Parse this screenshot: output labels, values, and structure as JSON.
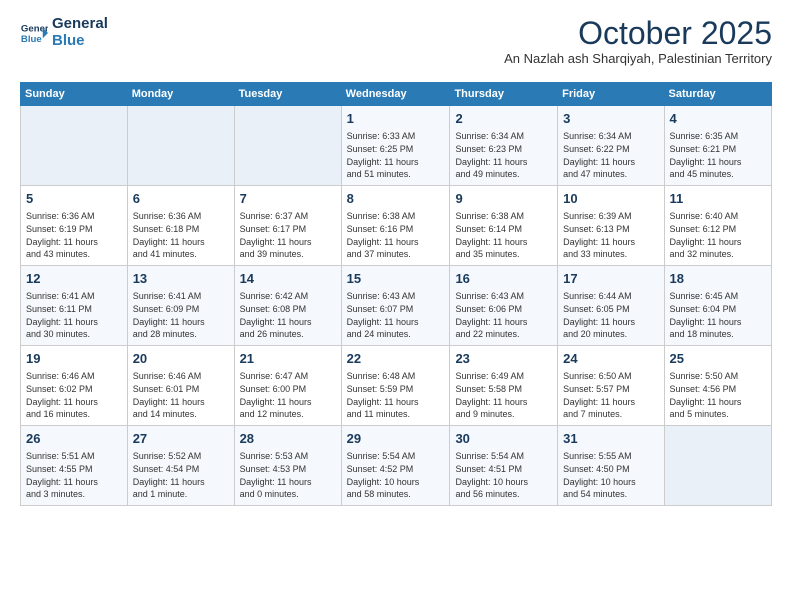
{
  "header": {
    "logo_line1": "General",
    "logo_line2": "Blue",
    "month": "October 2025",
    "location": "An Nazlah ash Sharqiyah, Palestinian Territory"
  },
  "weekdays": [
    "Sunday",
    "Monday",
    "Tuesday",
    "Wednesday",
    "Thursday",
    "Friday",
    "Saturday"
  ],
  "weeks": [
    [
      {
        "day": "",
        "info": ""
      },
      {
        "day": "",
        "info": ""
      },
      {
        "day": "",
        "info": ""
      },
      {
        "day": "1",
        "info": "Sunrise: 6:33 AM\nSunset: 6:25 PM\nDaylight: 11 hours\nand 51 minutes."
      },
      {
        "day": "2",
        "info": "Sunrise: 6:34 AM\nSunset: 6:23 PM\nDaylight: 11 hours\nand 49 minutes."
      },
      {
        "day": "3",
        "info": "Sunrise: 6:34 AM\nSunset: 6:22 PM\nDaylight: 11 hours\nand 47 minutes."
      },
      {
        "day": "4",
        "info": "Sunrise: 6:35 AM\nSunset: 6:21 PM\nDaylight: 11 hours\nand 45 minutes."
      }
    ],
    [
      {
        "day": "5",
        "info": "Sunrise: 6:36 AM\nSunset: 6:19 PM\nDaylight: 11 hours\nand 43 minutes."
      },
      {
        "day": "6",
        "info": "Sunrise: 6:36 AM\nSunset: 6:18 PM\nDaylight: 11 hours\nand 41 minutes."
      },
      {
        "day": "7",
        "info": "Sunrise: 6:37 AM\nSunset: 6:17 PM\nDaylight: 11 hours\nand 39 minutes."
      },
      {
        "day": "8",
        "info": "Sunrise: 6:38 AM\nSunset: 6:16 PM\nDaylight: 11 hours\nand 37 minutes."
      },
      {
        "day": "9",
        "info": "Sunrise: 6:38 AM\nSunset: 6:14 PM\nDaylight: 11 hours\nand 35 minutes."
      },
      {
        "day": "10",
        "info": "Sunrise: 6:39 AM\nSunset: 6:13 PM\nDaylight: 11 hours\nand 33 minutes."
      },
      {
        "day": "11",
        "info": "Sunrise: 6:40 AM\nSunset: 6:12 PM\nDaylight: 11 hours\nand 32 minutes."
      }
    ],
    [
      {
        "day": "12",
        "info": "Sunrise: 6:41 AM\nSunset: 6:11 PM\nDaylight: 11 hours\nand 30 minutes."
      },
      {
        "day": "13",
        "info": "Sunrise: 6:41 AM\nSunset: 6:09 PM\nDaylight: 11 hours\nand 28 minutes."
      },
      {
        "day": "14",
        "info": "Sunrise: 6:42 AM\nSunset: 6:08 PM\nDaylight: 11 hours\nand 26 minutes."
      },
      {
        "day": "15",
        "info": "Sunrise: 6:43 AM\nSunset: 6:07 PM\nDaylight: 11 hours\nand 24 minutes."
      },
      {
        "day": "16",
        "info": "Sunrise: 6:43 AM\nSunset: 6:06 PM\nDaylight: 11 hours\nand 22 minutes."
      },
      {
        "day": "17",
        "info": "Sunrise: 6:44 AM\nSunset: 6:05 PM\nDaylight: 11 hours\nand 20 minutes."
      },
      {
        "day": "18",
        "info": "Sunrise: 6:45 AM\nSunset: 6:04 PM\nDaylight: 11 hours\nand 18 minutes."
      }
    ],
    [
      {
        "day": "19",
        "info": "Sunrise: 6:46 AM\nSunset: 6:02 PM\nDaylight: 11 hours\nand 16 minutes."
      },
      {
        "day": "20",
        "info": "Sunrise: 6:46 AM\nSunset: 6:01 PM\nDaylight: 11 hours\nand 14 minutes."
      },
      {
        "day": "21",
        "info": "Sunrise: 6:47 AM\nSunset: 6:00 PM\nDaylight: 11 hours\nand 12 minutes."
      },
      {
        "day": "22",
        "info": "Sunrise: 6:48 AM\nSunset: 5:59 PM\nDaylight: 11 hours\nand 11 minutes."
      },
      {
        "day": "23",
        "info": "Sunrise: 6:49 AM\nSunset: 5:58 PM\nDaylight: 11 hours\nand 9 minutes."
      },
      {
        "day": "24",
        "info": "Sunrise: 6:50 AM\nSunset: 5:57 PM\nDaylight: 11 hours\nand 7 minutes."
      },
      {
        "day": "25",
        "info": "Sunrise: 5:50 AM\nSunset: 4:56 PM\nDaylight: 11 hours\nand 5 minutes."
      }
    ],
    [
      {
        "day": "26",
        "info": "Sunrise: 5:51 AM\nSunset: 4:55 PM\nDaylight: 11 hours\nand 3 minutes."
      },
      {
        "day": "27",
        "info": "Sunrise: 5:52 AM\nSunset: 4:54 PM\nDaylight: 11 hours\nand 1 minute."
      },
      {
        "day": "28",
        "info": "Sunrise: 5:53 AM\nSunset: 4:53 PM\nDaylight: 11 hours\nand 0 minutes."
      },
      {
        "day": "29",
        "info": "Sunrise: 5:54 AM\nSunset: 4:52 PM\nDaylight: 10 hours\nand 58 minutes."
      },
      {
        "day": "30",
        "info": "Sunrise: 5:54 AM\nSunset: 4:51 PM\nDaylight: 10 hours\nand 56 minutes."
      },
      {
        "day": "31",
        "info": "Sunrise: 5:55 AM\nSunset: 4:50 PM\nDaylight: 10 hours\nand 54 minutes."
      },
      {
        "day": "",
        "info": ""
      }
    ]
  ]
}
